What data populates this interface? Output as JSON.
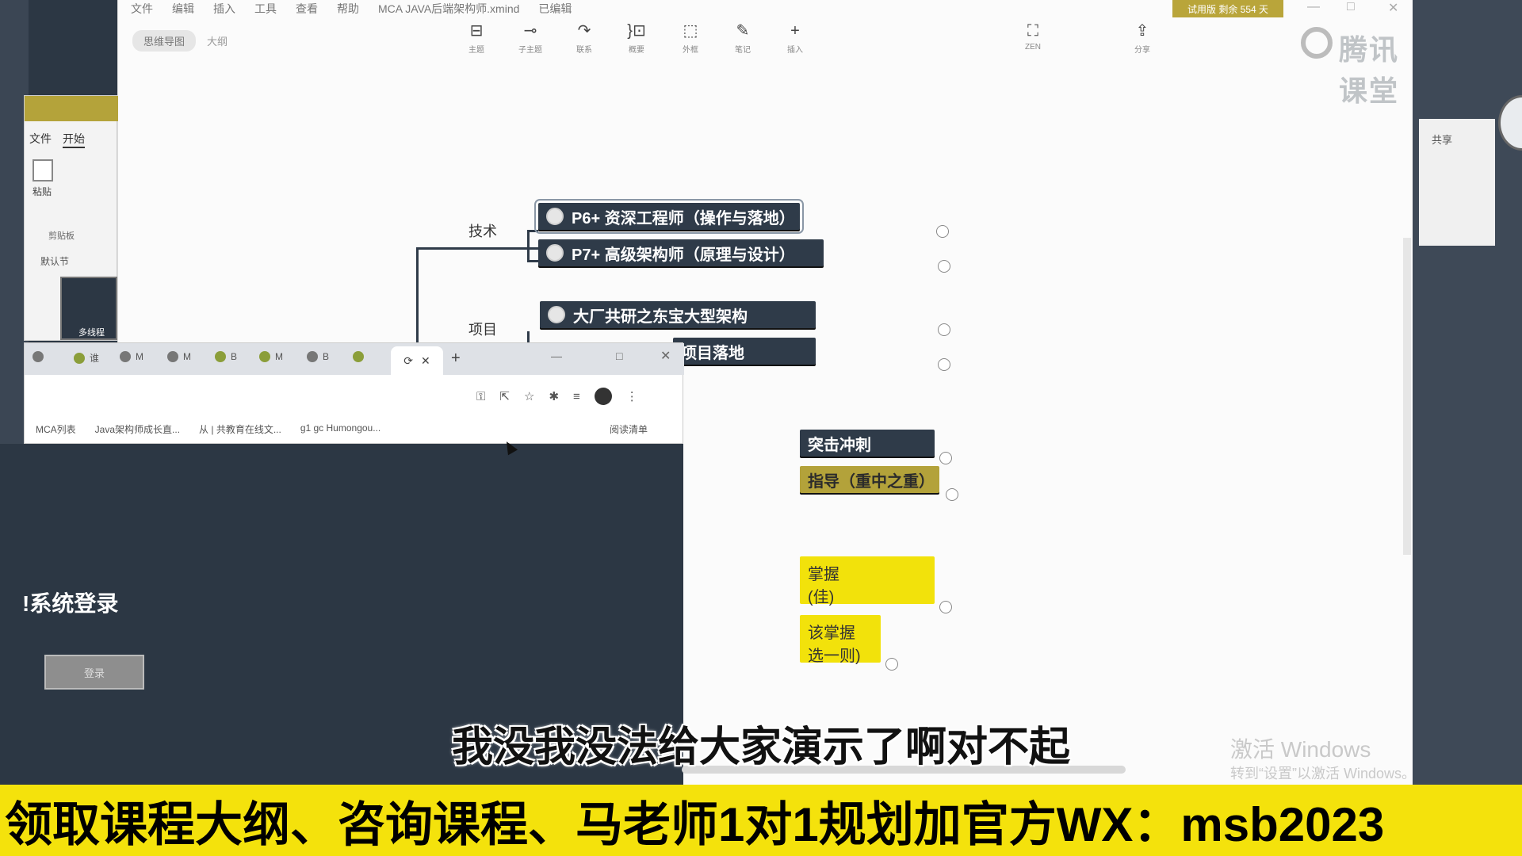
{
  "xmind": {
    "menu": [
      "文件",
      "编辑",
      "插入",
      "工具",
      "查看",
      "帮助",
      "MCA JAVA后端架构师.xmind",
      "已编辑"
    ],
    "trial_badge": "试用版 剩余 554 天",
    "window_controls": [
      "—",
      "□",
      "✕"
    ],
    "tabs": {
      "mindmap": "思维导图",
      "outline": "大纲"
    },
    "toolbar": [
      {
        "icon": "⊟",
        "label": "主题"
      },
      {
        "icon": "⊸",
        "label": "子主题"
      },
      {
        "icon": "↷",
        "label": "联系"
      },
      {
        "icon": "}⊡",
        "label": "概要"
      },
      {
        "icon": "⬚",
        "label": "外框"
      },
      {
        "icon": "✎",
        "label": "笔记"
      },
      {
        "icon": "+",
        "label": "插入"
      },
      {
        "icon": "⛶",
        "label": "ZEN"
      },
      {
        "icon": "⇪",
        "label": "分享"
      }
    ],
    "brand": "腾讯课堂",
    "map": {
      "branch_tech": "技术",
      "branch_project": "项目",
      "nodes": [
        "P6+ 资深工程师（操作与落地）",
        "P7+ 高级架构师（原理与设计）",
        "大厂共研之东宝大型架构",
        "项目落地",
        "突击冲刺",
        "指导（重中之重）",
        "掌握\n(佳)",
        "该掌握\n选一则)"
      ]
    }
  },
  "ppt": {
    "tabs": [
      "文件",
      "开始"
    ],
    "paste": "粘贴",
    "clipboard": "剪贴板",
    "default_section": "默认节",
    "slide_label": "多线程"
  },
  "browser": {
    "tabs": [
      "谁",
      "M",
      "M",
      "B",
      "M",
      "B"
    ],
    "active_tab_close": "✕",
    "new_tab": "+",
    "bookmarks": [
      "MCA列表",
      "Java架构师成长直...",
      "从 | 共教育在线文...",
      "g1 gc Humongou..."
    ],
    "reading_list": "阅读清单"
  },
  "login": {
    "title": "!系统登录",
    "button": "登录"
  },
  "right": {
    "share": "共享"
  },
  "watermark": {
    "line1": "激活 Windows",
    "line2": "转到“设置”以激活 Windows。"
  },
  "subtitle": "我没我没法给大家演示了啊对不起",
  "banner": "领取课程大纲、咨询课程、马老师1对1规划加官方WX：msb2023"
}
